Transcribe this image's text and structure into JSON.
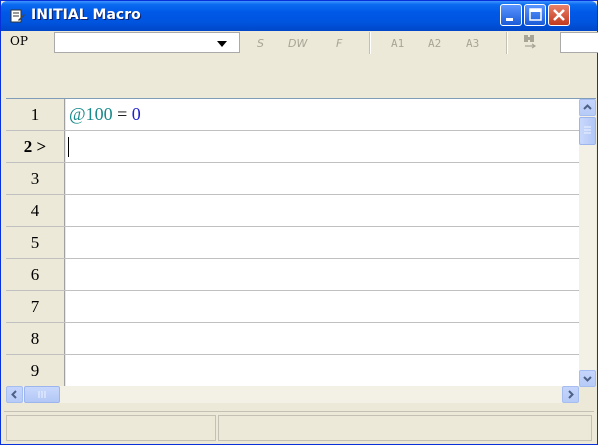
{
  "window": {
    "title": "INITIAL Macro"
  },
  "toolbar": {
    "op_label": "OP",
    "combo_value": "",
    "buttons": [
      {
        "label": "S"
      },
      {
        "label": "DW"
      },
      {
        "label": "F"
      },
      {
        "label": "A1"
      },
      {
        "label": "A2"
      },
      {
        "label": "A3"
      }
    ]
  },
  "rows": [
    {
      "num": "1",
      "text": ""
    },
    {
      "num": "2 >",
      "text": ""
    },
    {
      "num": "3",
      "text": ""
    },
    {
      "num": "4",
      "text": ""
    },
    {
      "num": "5",
      "text": ""
    },
    {
      "num": "6",
      "text": ""
    },
    {
      "num": "7",
      "text": ""
    },
    {
      "num": "8",
      "text": ""
    },
    {
      "num": "9",
      "text": ""
    }
  ],
  "row1_tokens": {
    "var": "@100",
    "op": "=",
    "val": "0"
  },
  "colors": {
    "title_bar": "#0058e6",
    "variable": "#1a8a8a",
    "number": "#1f1fd0",
    "close_button": "#c3391d"
  }
}
